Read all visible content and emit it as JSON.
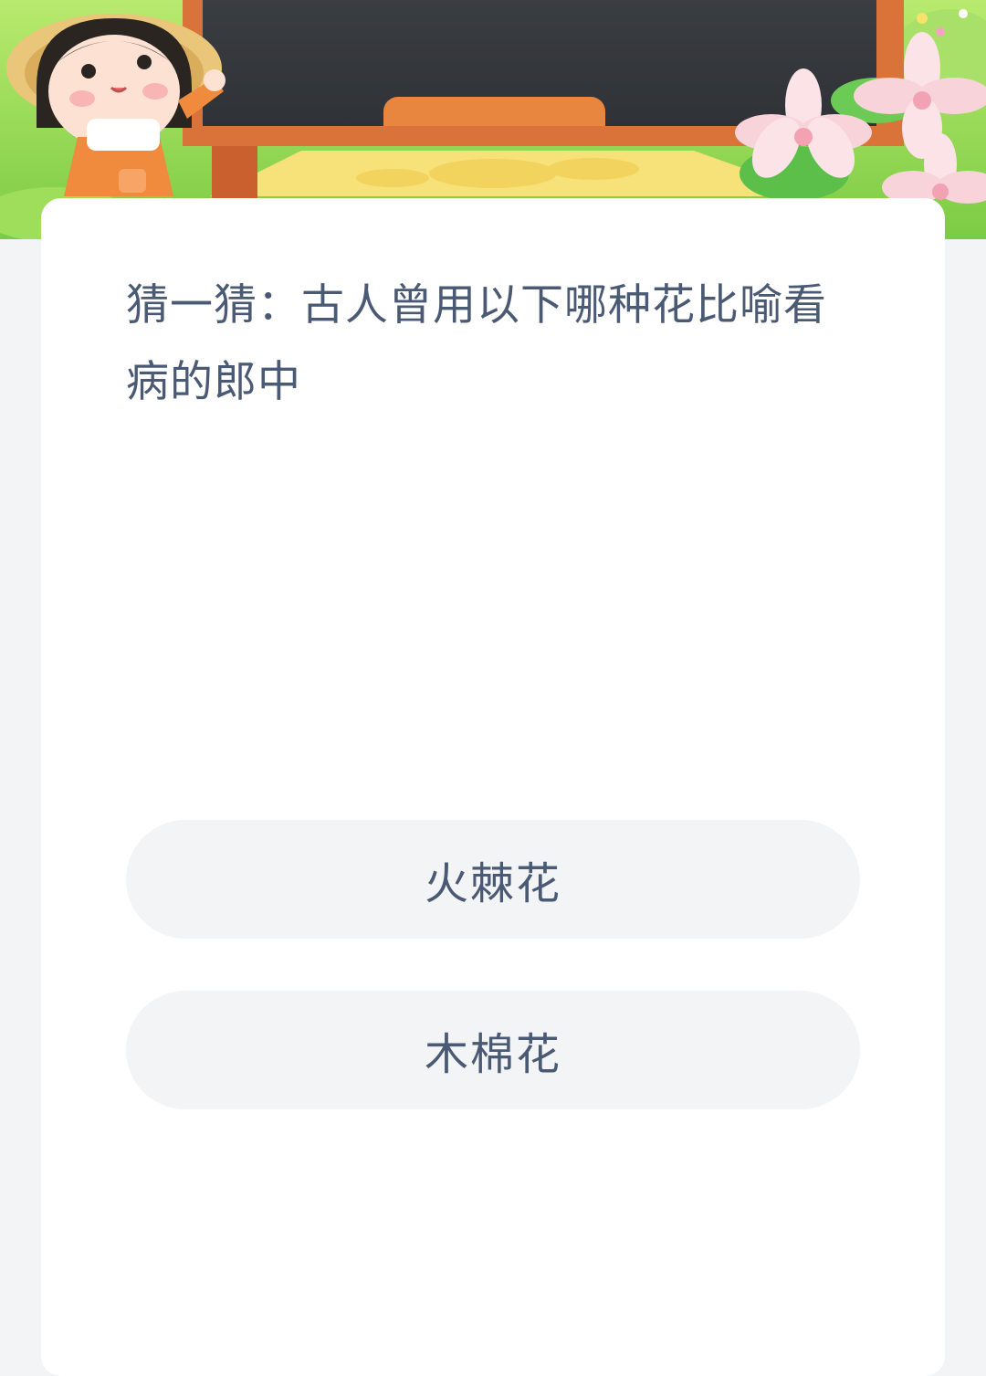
{
  "quiz": {
    "question": "猜一猜：古人曾用以下哪种花比喻看病的郎中",
    "options": [
      {
        "label": "火棘花"
      },
      {
        "label": "木棉花"
      }
    ]
  },
  "colors": {
    "page_background": "#f3f4f6",
    "card_background": "#ffffff",
    "option_background": "#f3f4f6",
    "text": "#4b5a74",
    "chalkboard": "#34373b",
    "board_frame": "#d9733a",
    "grass": "#8fd44f"
  },
  "icons": {
    "banner": "girl-chalkboard-flowers-illustration"
  }
}
